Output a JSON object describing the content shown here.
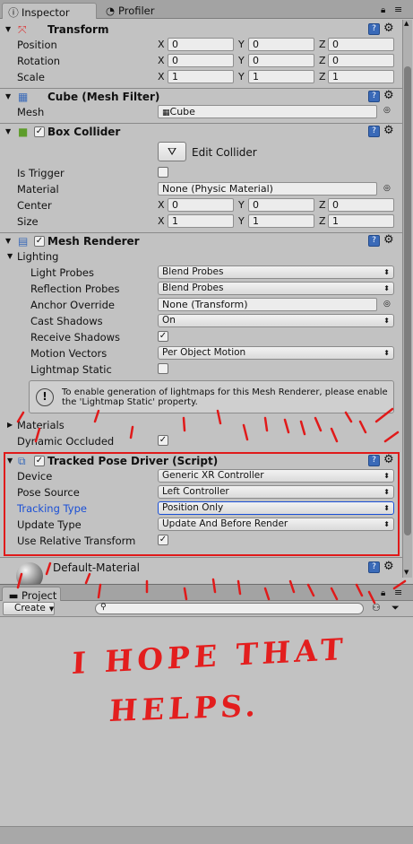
{
  "tabs": {
    "inspector": "Inspector",
    "profiler": "Profiler"
  },
  "transform": {
    "title": "Transform",
    "rows": [
      {
        "label": "Position",
        "x": "0",
        "y": "0",
        "z": "0"
      },
      {
        "label": "Rotation",
        "x": "0",
        "y": "0",
        "z": "0"
      },
      {
        "label": "Scale",
        "x": "1",
        "y": "1",
        "z": "1"
      }
    ]
  },
  "axes": {
    "x": "X",
    "y": "Y",
    "z": "Z"
  },
  "meshfilter": {
    "title": "Cube (Mesh Filter)",
    "mesh_label": "Mesh",
    "mesh_value": "Cube"
  },
  "boxcollider": {
    "title": "Box Collider",
    "edit_button": "Edit Collider",
    "is_trigger": "Is Trigger",
    "material_label": "Material",
    "material_value": "None (Physic Material)",
    "center": {
      "label": "Center",
      "x": "0",
      "y": "0",
      "z": "0"
    },
    "size": {
      "label": "Size",
      "x": "1",
      "y": "1",
      "z": "1"
    }
  },
  "meshrenderer": {
    "title": "Mesh Renderer",
    "lighting": "Lighting",
    "light_probes": {
      "label": "Light Probes",
      "value": "Blend Probes"
    },
    "reflection_probes": {
      "label": "Reflection Probes",
      "value": "Blend Probes"
    },
    "anchor_override": {
      "label": "Anchor Override",
      "value": "None (Transform)"
    },
    "cast_shadows": {
      "label": "Cast Shadows",
      "value": "On"
    },
    "receive_shadows": "Receive Shadows",
    "motion_vectors": {
      "label": "Motion Vectors",
      "value": "Per Object Motion"
    },
    "lightmap_static": "Lightmap Static",
    "info": "To enable generation of lightmaps for this Mesh Renderer, please enable the 'Lightmap Static' property.",
    "materials": "Materials",
    "dynamic_occluded": "Dynamic Occluded"
  },
  "tpd": {
    "title": "Tracked Pose Driver (Script)",
    "device": {
      "label": "Device",
      "value": "Generic XR Controller"
    },
    "pose_source": {
      "label": "Pose Source",
      "value": "Left Controller"
    },
    "tracking_type": {
      "label": "Tracking Type",
      "value": "Position Only"
    },
    "update_type": {
      "label": "Update Type",
      "value": "Update And Before Render"
    },
    "relative": "Use Relative Transform"
  },
  "material": {
    "name": "Default-Material"
  },
  "project": {
    "tab": "Project",
    "create": "Create"
  },
  "annotation": {
    "line1": "I HOPE THAT",
    "line2": "HELPS."
  },
  "colors": {
    "annotation": "#e01a1a",
    "link_blue": "#1a4fd6"
  }
}
